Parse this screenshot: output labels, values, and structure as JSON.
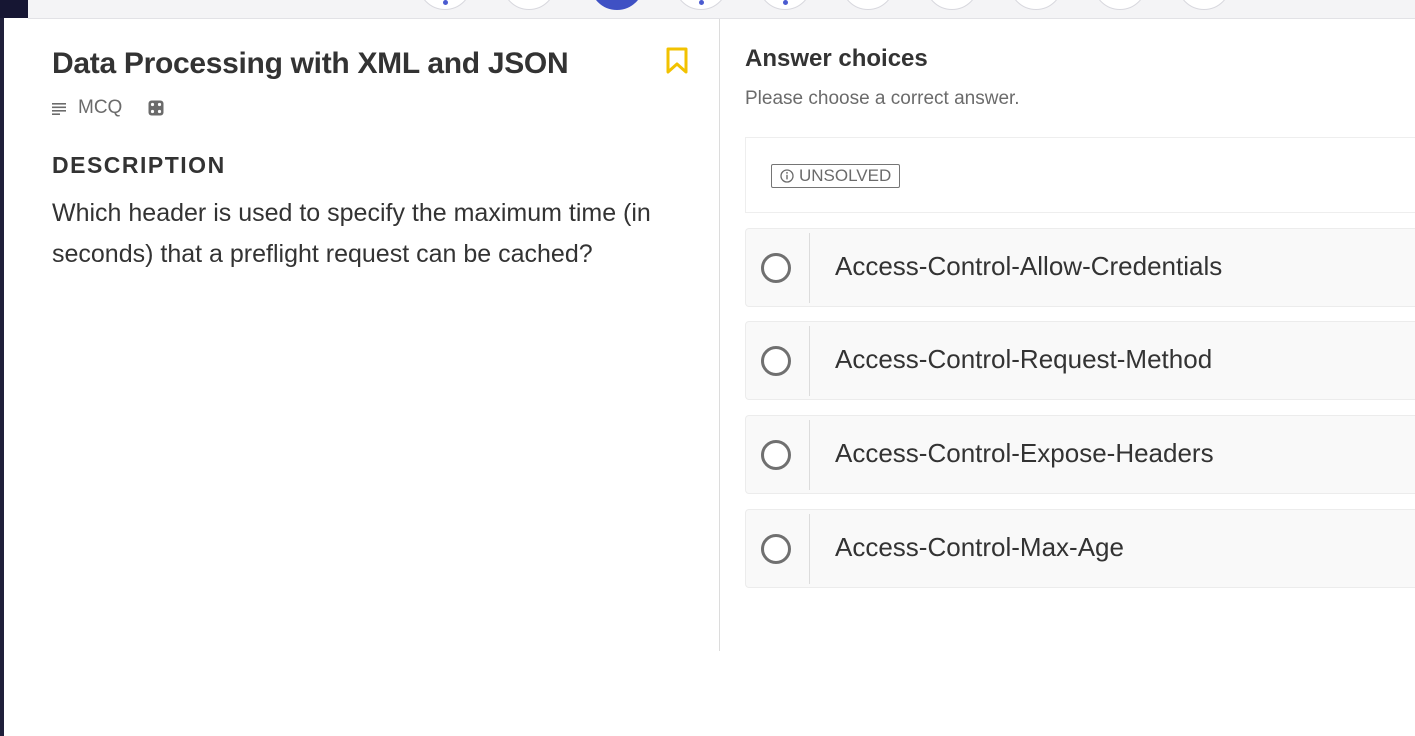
{
  "header": {
    "question_dots": [
      {
        "state": "answered"
      },
      {
        "state": "plain"
      },
      {
        "state": "active"
      },
      {
        "state": "answered"
      },
      {
        "state": "answered"
      },
      {
        "state": "plain"
      },
      {
        "state": "plain"
      },
      {
        "state": "plain"
      },
      {
        "state": "plain"
      },
      {
        "state": "plain"
      }
    ]
  },
  "question": {
    "title": "Data Processing with XML and JSON",
    "type": "MCQ",
    "description_heading": "DESCRIPTION",
    "description": "Which header is used to specify the maximum time (in seconds) that a preflight request can be cached?",
    "bookmark_icon": "bookmark-icon"
  },
  "answers": {
    "title": "Answer choices",
    "subtitle": "Please choose a correct answer.",
    "status": "UNSOLVED",
    "choices": [
      {
        "label": "Access-Control-Allow-Credentials"
      },
      {
        "label": "Access-Control-Request-Method"
      },
      {
        "label": "Access-Control-Expose-Headers"
      },
      {
        "label": "Access-Control-Max-Age"
      }
    ]
  },
  "colors": {
    "accent": "#3f51c4",
    "bookmark": "#f2c200",
    "text": "#333333",
    "muted": "#6b6b6b"
  }
}
